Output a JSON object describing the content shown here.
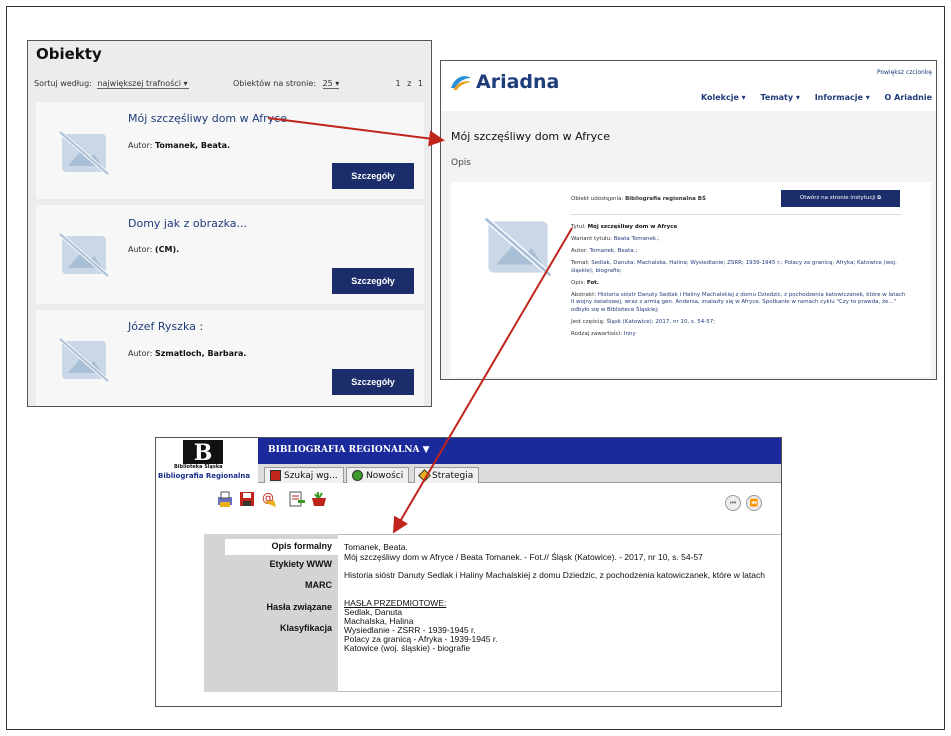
{
  "panel_objects": {
    "title": "Obiekty",
    "sort_label": "Sortuj według:",
    "sort_value": "największej trafności",
    "per_page_label": "Obiektów na stronie:",
    "per_page_value": "25",
    "pagination": "1 z 1",
    "items": [
      {
        "title": "Mój szczęśliwy dom w Afryce",
        "author_label": "Autor:",
        "author": "Tomanek, Beata.",
        "button": "Szczegóły"
      },
      {
        "title": "Domy jak z obrazka...",
        "author_label": "Autor:",
        "author": "(CM).",
        "button": "Szczegóły"
      },
      {
        "title": "Józef Ryszka :",
        "author_label": "Autor:",
        "author": "Szmatloch, Barbara.",
        "button": "Szczegóły"
      }
    ]
  },
  "panel_ariadna": {
    "logo": "Ariadna",
    "zoom_link": "Powiększ czcionkę",
    "nav": [
      "Kolekcje ▾",
      "Tematy ▾",
      "Informacje ▾",
      "O Ariadnie"
    ],
    "title": "Mój szczęśliwy dom w Afryce",
    "section": "Opis",
    "shared_label": "Obiekt udostępnia:",
    "shared_value": "Bibliografia regionalna BŚ",
    "open_button": "Otwórz na stronie instytucji ⧉",
    "meta": [
      {
        "label": "Tytuł:",
        "value": "Mój szczęśliwy dom w Afryce"
      },
      {
        "label": "Wariant tytułu:",
        "value": "Beata Tomanek.;"
      },
      {
        "label": "Autor:",
        "value": "Tomanek, Beata.;"
      },
      {
        "label": "Temat:",
        "value": "Sedlak, Danuta; Machalska, Halina; Wysiedlanie; ZSRR; 1939-1945 r.; Polacy za granicą; Afryka; Katowice (woj. śląskie); biografie;"
      },
      {
        "label": "Opis:",
        "value": "Fot."
      },
      {
        "label": "Abstrakt:",
        "value": "Historia sióstr Danuty Sedlak i Haliny Machalskiej z domu Dziedzic, z pochodzenia katowiczanek, które w latach II wojny światowej, wraz z armią gen. Andersa, znalazły się w Afryce. Spotkanie w ramach cyklu \"Czy to prawda, że...\" odbyło się w Bibliotece Śląskiej;"
      },
      {
        "label": "Jest częścią:",
        "value": "Śląsk (Katowice); 2017, nr 10, s. 54-57;"
      },
      {
        "label": "Rodzaj zawartości:",
        "value": "Inny"
      }
    ]
  },
  "panel_bibliografia": {
    "logo_small": "Biblioteka Śląska",
    "logo_big": "Bibliografia Regionalna",
    "topbar": "BIBLIOGRAFIA REGIONALNA ▼",
    "tabs": [
      "Szukaj wg...",
      "Nowości",
      "Strategia"
    ],
    "nav_prev": "⏮",
    "nav_back": "⏪",
    "side": [
      "Opis formalny",
      "Etykiety WWW",
      "MARC",
      "Hasła związane",
      "Klasyfikacja"
    ],
    "content": {
      "line1": "Tomanek, Beata.",
      "line2": "Mój szczęśliwy dom w Afryce / Beata Tomanek. - Fot.// Śląsk (Katowice). - 2017, nr 10, s. 54-57",
      "line3": "Historia sióstr Danuty Sedlak i Haliny Machalskiej z domu Dziedzic, z pochodzenia katowiczanek, które w latach",
      "subjects_header": "HASŁA PRZEDMIOTOWE:",
      "subjects": [
        "Sedlak, Danuta",
        "Machalska, Halina",
        "Wysiedlanie - ZSRR - 1939-1945 r.",
        "Polacy za granicą - Afryka - 1939-1945 r.",
        "Katowice (woj. śląskie) - biografie"
      ]
    }
  },
  "colors": {
    "navy": "#1b2d6b",
    "link": "#1f3c7a",
    "arrow": "#c0241b",
    "topbar": "#1a2a9a"
  }
}
